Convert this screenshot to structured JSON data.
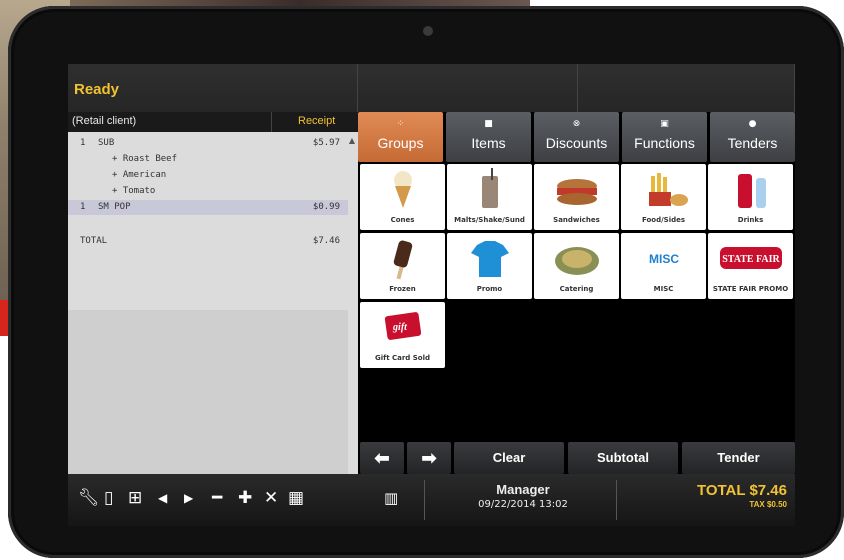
{
  "status": {
    "text": "Ready"
  },
  "receipt": {
    "client": "(Retail client)",
    "label": "Receipt",
    "lines": [
      {
        "qty": "1",
        "name": "SUB",
        "price": "$5.97"
      },
      {
        "qty": "",
        "name": "+ Roast Beef",
        "price": ""
      },
      {
        "qty": "",
        "name": "+ American",
        "price": ""
      },
      {
        "qty": "",
        "name": "+ Tomato",
        "price": ""
      },
      {
        "qty": "1",
        "name": "SM POP",
        "price": "$0.99"
      }
    ],
    "total_label": "TOTAL",
    "total_value": "$7.46"
  },
  "tabs": [
    {
      "label": "Groups",
      "icon": "groups-icon",
      "active": true
    },
    {
      "label": "Items",
      "icon": "items-icon",
      "active": false
    },
    {
      "label": "Discounts",
      "icon": "discounts-icon",
      "active": false
    },
    {
      "label": "Functions",
      "icon": "functions-icon",
      "active": false
    },
    {
      "label": "Tenders",
      "icon": "tenders-icon",
      "active": false
    }
  ],
  "tiles": [
    {
      "label": "Cones",
      "icon": "ice-cream-cone-icon"
    },
    {
      "label": "Malts/Shake/Sund",
      "icon": "shake-cup-icon"
    },
    {
      "label": "Sandwiches",
      "icon": "sandwich-icon"
    },
    {
      "label": "Food/Sides",
      "icon": "fries-icon"
    },
    {
      "label": "Drinks",
      "icon": "drinks-icon"
    },
    {
      "label": "Frozen",
      "icon": "ice-cream-bar-icon"
    },
    {
      "label": "Promo",
      "icon": "tshirt-icon"
    },
    {
      "label": "Catering",
      "icon": "platter-icon"
    },
    {
      "label": "MISC",
      "icon": "misc-icon",
      "art_text": "MISC"
    },
    {
      "label": "STATE FAIR PROMO",
      "icon": "state-fair-logo-icon",
      "art_text": "STATE FAIR"
    },
    {
      "label": "Gift Card Sold",
      "icon": "gift-card-icon",
      "art_text": "gift"
    }
  ],
  "actions": {
    "back": "back-arrow-icon",
    "forward": "forward-arrow-icon",
    "clear": "Clear",
    "subtotal": "Subtotal",
    "tender": "Tender"
  },
  "toolbar": {
    "icons": [
      "wrench-icon",
      "document-icon",
      "grid-icon",
      "previous-icon",
      "next-icon",
      "minus-icon",
      "plus-icon",
      "delete-icon",
      "calculator-icon",
      "barcode-icon"
    ],
    "user": "Manager",
    "datetime": "09/22/2014 13:02",
    "total": "TOTAL $7.46",
    "tax": "TAX $0.50"
  }
}
